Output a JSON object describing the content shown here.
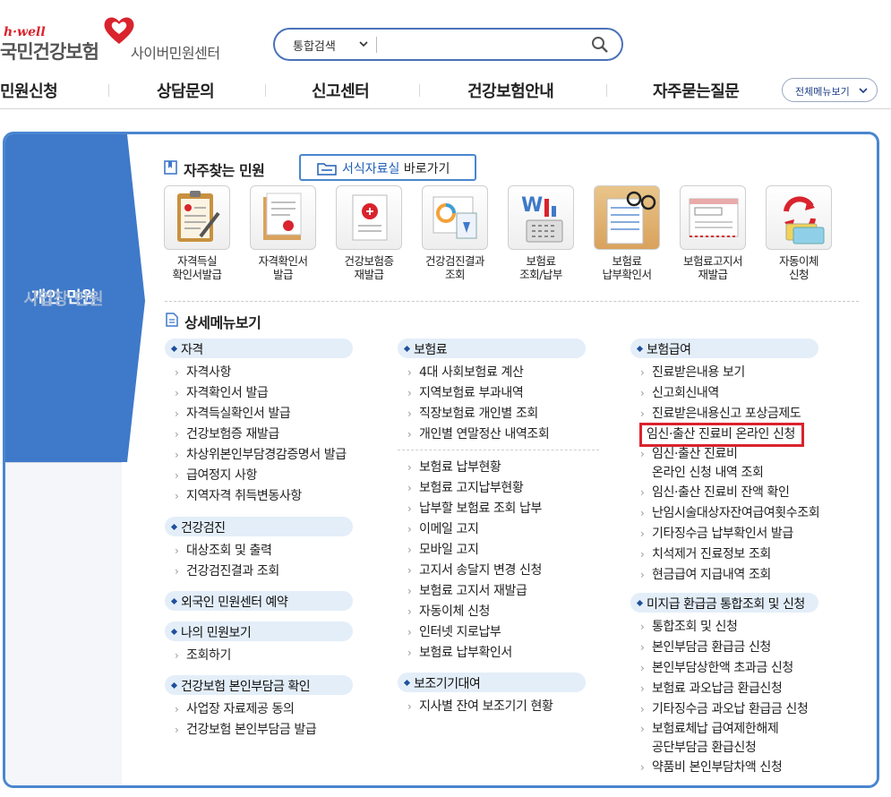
{
  "header": {
    "logo_tag": "h·well",
    "logo_brand": "국민건강보험",
    "logo_sub": "사이버민원센터",
    "search_scope": "통합검색",
    "search_value": "",
    "search_placeholder": ""
  },
  "gnb": {
    "items": [
      "민원신청",
      "상담문의",
      "신고센터",
      "건강보험안내",
      "자주묻는질문"
    ],
    "all_menu": "전체메뉴보기"
  },
  "side": {
    "personal": "개인 민원",
    "business": "사업장 민원"
  },
  "quick": {
    "title": "자주찾는 민원",
    "forms_button_blue": "서식자료실",
    "forms_button_rest": " 바로가기",
    "items": [
      {
        "line1": "자격득실",
        "line2": "확인서발급",
        "icon": "clipboard-icon"
      },
      {
        "line1": "자격확인서",
        "line2": "발급",
        "icon": "certificate-icon"
      },
      {
        "line1": "건강보험증",
        "line2": "재발급",
        "icon": "insurance-card-icon"
      },
      {
        "line1": "건강검진결과",
        "line2": "조회",
        "icon": "checkup-chart-icon"
      },
      {
        "line1": "보험료",
        "line2": "조회/납부",
        "icon": "calculator-icon"
      },
      {
        "line1": "보험료",
        "line2": "납부확인서",
        "icon": "receipt-glasses-icon"
      },
      {
        "line1": "보험료고지서",
        "line2": "재발급",
        "icon": "bill-icon"
      },
      {
        "line1": "자동이체",
        "line2": "신청",
        "icon": "auto-transfer-icon"
      }
    ]
  },
  "detail": {
    "title": "상세메뉴보기",
    "col1": {
      "cat1": "자격",
      "cat1_links": [
        "자격사항",
        "자격확인서 발급",
        "자격득실확인서 발급",
        "건강보험증 재발급",
        "차상위본인부담경감증명서 발급",
        "급여정지 사항",
        "지역자격 취득변동사항"
      ],
      "cat2": "건강검진",
      "cat2_links": [
        "대상조회 및 출력",
        "건강검진결과 조회"
      ],
      "cat3": "외국인 민원센터 예약",
      "cat4": "나의 민원보기",
      "cat4_links": [
        "조회하기"
      ],
      "cat5": "건강보험 본인부담금 확인",
      "cat5_links": [
        "사업장 자료제공 동의",
        "건강보험 본인부담금 발급"
      ]
    },
    "col2": {
      "cat1": "보험료",
      "cat1_links_a": [
        "4대 사회보험료 계산",
        "지역보험료 부과내역",
        "직장보험료 개인별 조회",
        "개인별 연말정산 내역조회"
      ],
      "cat1_links_b": [
        "보험료 납부현황",
        "보험료 고지납부현황",
        "납부할 보험료 조회 납부",
        "이메일 고지",
        "모바일 고지",
        "고지서 송달지 변경 신청",
        "보험료 고지서 재발급",
        "자동이체 신청",
        "인터넷 지로납부",
        "보험료 납부확인서"
      ],
      "cat2": "보조기기대여",
      "cat2_links": [
        "지사별 잔여 보조기기 현황"
      ]
    },
    "col3": {
      "cat1": "보험급여",
      "cat1_links_a": [
        "진료받은내용 보기",
        "신고회신내역",
        "진료받은내용신고 포상금제도"
      ],
      "highlighted": "임신·출산 진료비 온라인 신청",
      "cat1_links_b1": "임신·출산 진료비",
      "cat1_links_b2": "온라인 신청 내역 조회",
      "cat1_links_c": [
        "임신·출산 진료비 잔액 확인",
        "난임시술대상자잔여급여횟수조회",
        "기타징수금 납부확인서 발급",
        "치석제거 진료정보 조회",
        "현금급여 지급내역 조회"
      ],
      "cat2": "미지급 환급금 통합조회 및 신청",
      "cat2_links_a": [
        "통합조회 및 신청",
        "본인부담금 환급금 신청",
        "본인부담상한액 초과금 신청",
        "보험료 과오납금 환급신청",
        "기타징수금 과오납 환급금 신청"
      ],
      "cat2_link_b1": "보험료체납 급여제한해제",
      "cat2_link_b2": "공단부담금 환급신청",
      "cat2_links_c": [
        "약품비 본인부담차액 신청"
      ]
    }
  },
  "colors": {
    "accent_blue": "#3f79c9",
    "brand_red": "#d9232d",
    "category_bg": "#e3eef9"
  }
}
